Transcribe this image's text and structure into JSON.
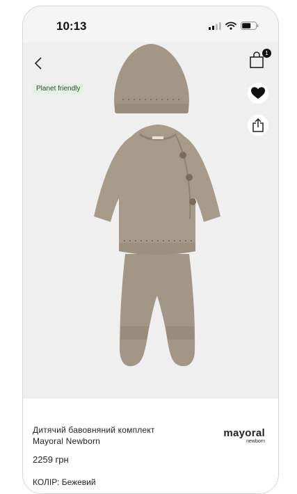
{
  "status_bar": {
    "time": "10:13",
    "icons": [
      "signal-icon",
      "wifi-icon",
      "battery-icon"
    ]
  },
  "header": {
    "back_icon": "chevron-left-icon",
    "bag_icon": "shopping-bag-icon",
    "bag_count": "1"
  },
  "actions": {
    "favorite_icon": "heart-icon",
    "share_icon": "share-icon"
  },
  "product": {
    "tag": "Planet friendly",
    "title": "Дитячий бавовняний комплект Mayoral Newborn",
    "price": "2259 грн",
    "color_label": "КОЛІР:",
    "color_value": "Бежевий",
    "brand": "mayoral",
    "brand_sub": "newborn",
    "image_count": 2,
    "active_image": 1
  },
  "colors": {
    "product_beige": "#a39686",
    "tag_bg": "#e4f1e2",
    "tag_text": "#2f4a36",
    "background": "#efefef"
  }
}
